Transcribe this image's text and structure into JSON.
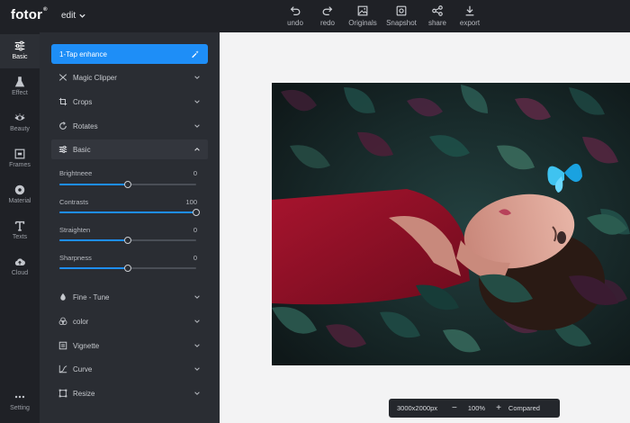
{
  "app": {
    "logo": "fotor",
    "logo_mark": "®",
    "edit_menu": "edit"
  },
  "toolbar": [
    {
      "key": "undo",
      "label": "undo",
      "icon": "undo-icon"
    },
    {
      "key": "redo",
      "label": "redo",
      "icon": "redo-icon"
    },
    {
      "key": "originals",
      "label": "Originals",
      "icon": "image-icon"
    },
    {
      "key": "snapshot",
      "label": "Snapshot",
      "icon": "camera-icon"
    },
    {
      "key": "share",
      "label": "share",
      "icon": "share-icon"
    },
    {
      "key": "export",
      "label": "export",
      "icon": "download-icon"
    }
  ],
  "rail": [
    {
      "label": "Basic",
      "icon": "sliders-icon",
      "active": true
    },
    {
      "label": "Effect",
      "icon": "flask-icon",
      "active": false
    },
    {
      "label": "Beauty",
      "icon": "eye-icon",
      "active": false
    },
    {
      "label": "Frames",
      "icon": "frame-icon",
      "active": false
    },
    {
      "label": "Material",
      "icon": "material-icon",
      "active": false
    },
    {
      "label": "Texts",
      "icon": "text-icon",
      "active": false
    },
    {
      "label": "Cloud",
      "icon": "cloud-upload-icon",
      "active": false
    },
    {
      "label": "Setting",
      "icon": "more-dots-icon",
      "active": false
    }
  ],
  "panel": {
    "enhance_label": "1-Tap enhance",
    "sections_top": [
      {
        "label": "Magic Clipper",
        "icon": "scissors-icon"
      },
      {
        "label": "Crops",
        "icon": "crop-icon"
      },
      {
        "label": "Rotates",
        "icon": "rotate-icon"
      }
    ],
    "basic_section": {
      "label": "Basic",
      "icon": "sliders-icon"
    },
    "sliders": [
      {
        "label": "Brightneee",
        "value": "0",
        "fraction": 0.5
      },
      {
        "label": "Contrasts",
        "value": "100",
        "fraction": 1.0
      },
      {
        "label": "Straighten",
        "value": "0",
        "fraction": 0.5
      },
      {
        "label": "Sharpness",
        "value": "0",
        "fraction": 0.5
      }
    ],
    "sections_bottom": [
      {
        "label": "Fine - Tune",
        "icon": "drop-icon"
      },
      {
        "label": "color",
        "icon": "color-circles-icon"
      },
      {
        "label": "Vignette",
        "icon": "vignette-icon"
      },
      {
        "label": "Curve",
        "icon": "curve-icon"
      },
      {
        "label": "Resize",
        "icon": "resize-icon"
      }
    ]
  },
  "zoombar": {
    "dimensions": "3000x2000px",
    "minus": "−",
    "zoom": "100%",
    "plus": "+",
    "compare": "Compared"
  },
  "colors": {
    "accent": "#1e8ef7",
    "chrome": "#1f2126",
    "panel": "#2a2d33",
    "canvas": "#f3f3f4"
  }
}
